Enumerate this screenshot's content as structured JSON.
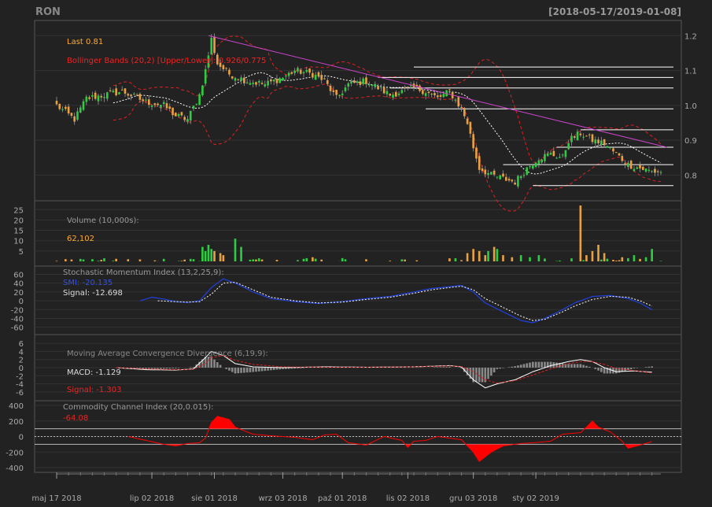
{
  "header": {
    "symbol": "RON",
    "range": "[2018-05-17/2019-01-08]"
  },
  "colors": {
    "up": "#2ecc40",
    "down": "#e8a040",
    "bbands": "#e02020",
    "sma": "#ffffff",
    "trend": "#cc44cc",
    "smi": "#2040e0",
    "cci": "#ff0000",
    "level": "#ffffff"
  },
  "chart_data": [
    {
      "type": "candlestick",
      "panel": "price",
      "labels": {
        "last": "Last 0.81",
        "bbands": "Bollinger Bands (20,2) [Upper/Lower]: 0.926/0.775"
      },
      "ylim": [
        0.74,
        1.23
      ],
      "yticks": [
        "0.8",
        "0.9",
        "1.0",
        "1.1",
        "1.2"
      ],
      "anchors": [
        [
          0,
          1.0
        ],
        [
          6,
          0.96
        ],
        [
          10,
          1.02
        ],
        [
          16,
          1.03
        ],
        [
          22,
          1.04
        ],
        [
          30,
          1.01
        ],
        [
          36,
          1.0
        ],
        [
          40,
          0.97
        ],
        [
          44,
          0.96
        ],
        [
          48,
          1.03
        ],
        [
          50,
          1.1
        ],
        [
          52,
          1.19
        ],
        [
          54,
          1.12
        ],
        [
          58,
          1.09
        ],
        [
          64,
          1.07
        ],
        [
          70,
          1.06
        ],
        [
          76,
          1.08
        ],
        [
          80,
          1.1
        ],
        [
          86,
          1.09
        ],
        [
          90,
          1.07
        ],
        [
          94,
          1.02
        ],
        [
          98,
          1.06
        ],
        [
          104,
          1.07
        ],
        [
          108,
          1.05
        ],
        [
          112,
          1.03
        ],
        [
          116,
          1.04
        ],
        [
          120,
          1.05
        ],
        [
          124,
          1.04
        ],
        [
          128,
          1.02
        ],
        [
          132,
          1.04
        ],
        [
          136,
          0.99
        ],
        [
          138,
          0.95
        ],
        [
          140,
          0.88
        ],
        [
          142,
          0.82
        ],
        [
          146,
          0.8
        ],
        [
          150,
          0.79
        ],
        [
          154,
          0.78
        ],
        [
          158,
          0.82
        ],
        [
          162,
          0.85
        ],
        [
          166,
          0.86
        ],
        [
          170,
          0.85
        ],
        [
          172,
          0.9
        ],
        [
          176,
          0.92
        ],
        [
          180,
          0.9
        ],
        [
          184,
          0.89
        ],
        [
          188,
          0.86
        ],
        [
          192,
          0.83
        ],
        [
          196,
          0.82
        ],
        [
          200,
          0.81
        ]
      ],
      "resistance_lines": [
        [
          120,
          1.11
        ],
        [
          108,
          1.08
        ],
        [
          112,
          1.05
        ],
        [
          124,
          0.99
        ],
        [
          176,
          0.93
        ],
        [
          168,
          0.88
        ],
        [
          150,
          0.83
        ],
        [
          160,
          0.77
        ]
      ],
      "trendline": [
        [
          51,
          1.2
        ],
        [
          205,
          0.88
        ]
      ]
    },
    {
      "type": "bar",
      "panel": "volume",
      "labels": {
        "title": "Volume (10,000s):",
        "last": "62,102"
      },
      "ylim": [
        0,
        27
      ],
      "yticks": [
        "5",
        "10",
        "15",
        "20",
        "25"
      ],
      "spikes": [
        [
          49,
          7
        ],
        [
          50,
          5
        ],
        [
          51,
          8
        ],
        [
          52,
          6
        ],
        [
          53,
          5
        ],
        [
          55,
          4
        ],
        [
          56,
          3
        ],
        [
          60,
          11
        ],
        [
          62,
          7
        ],
        [
          86,
          2
        ],
        [
          138,
          4
        ],
        [
          140,
          6
        ],
        [
          142,
          5
        ],
        [
          144,
          3
        ],
        [
          145,
          5
        ],
        [
          147,
          7
        ],
        [
          148,
          6
        ],
        [
          150,
          3
        ],
        [
          153,
          2
        ],
        [
          156,
          3
        ],
        [
          159,
          2
        ],
        [
          162,
          3
        ],
        [
          176,
          27
        ],
        [
          178,
          3
        ],
        [
          180,
          5
        ],
        [
          182,
          8
        ],
        [
          184,
          4
        ],
        [
          190,
          2
        ],
        [
          194,
          3
        ],
        [
          198,
          2
        ],
        [
          200,
          6
        ]
      ]
    },
    {
      "type": "line",
      "panel": "smi",
      "labels": {
        "title": "Stochastic Momentum Index (13,2,25,9):",
        "smi": "SMI: -20.135",
        "signal": "Signal: -12.698"
      },
      "ylim": [
        -66,
        68
      ],
      "yticks": [
        "-60",
        "-40",
        "-20",
        "0",
        "20",
        "40",
        "60"
      ],
      "smi_anchors": [
        [
          28,
          0
        ],
        [
          32,
          8
        ],
        [
          36,
          4
        ],
        [
          40,
          -2
        ],
        [
          44,
          -4
        ],
        [
          48,
          0
        ],
        [
          52,
          30
        ],
        [
          56,
          50
        ],
        [
          60,
          40
        ],
        [
          66,
          20
        ],
        [
          72,
          5
        ],
        [
          80,
          -2
        ],
        [
          88,
          -6
        ],
        [
          96,
          -2
        ],
        [
          104,
          5
        ],
        [
          112,
          10
        ],
        [
          120,
          20
        ],
        [
          126,
          28
        ],
        [
          132,
          32
        ],
        [
          136,
          35
        ],
        [
          140,
          20
        ],
        [
          144,
          -5
        ],
        [
          150,
          -25
        ],
        [
          156,
          -45
        ],
        [
          160,
          -50
        ],
        [
          164,
          -40
        ],
        [
          170,
          -20
        ],
        [
          174,
          -5
        ],
        [
          180,
          10
        ],
        [
          186,
          12
        ],
        [
          192,
          5
        ],
        [
          196,
          -5
        ],
        [
          200,
          -20
        ]
      ],
      "signal_anchors": [
        [
          34,
          0
        ],
        [
          40,
          -2
        ],
        [
          44,
          -3
        ],
        [
          48,
          -2
        ],
        [
          52,
          15
        ],
        [
          56,
          40
        ],
        [
          60,
          42
        ],
        [
          66,
          25
        ],
        [
          72,
          8
        ],
        [
          80,
          0
        ],
        [
          88,
          -5
        ],
        [
          96,
          -3
        ],
        [
          104,
          3
        ],
        [
          112,
          8
        ],
        [
          120,
          17
        ],
        [
          126,
          25
        ],
        [
          132,
          30
        ],
        [
          136,
          33
        ],
        [
          140,
          25
        ],
        [
          144,
          5
        ],
        [
          150,
          -15
        ],
        [
          156,
          -35
        ],
        [
          160,
          -45
        ],
        [
          164,
          -42
        ],
        [
          170,
          -25
        ],
        [
          174,
          -12
        ],
        [
          180,
          3
        ],
        [
          186,
          10
        ],
        [
          192,
          8
        ],
        [
          196,
          0
        ],
        [
          200,
          -12
        ]
      ]
    },
    {
      "type": "line",
      "panel": "macd",
      "labels": {
        "title": "Moving Average Convergence Divergence (6,19,9):",
        "macd": "MACD: -1.129",
        "signal": "Signal: -1.303"
      },
      "ylim": [
        -7,
        7
      ],
      "yticks": [
        "-6",
        "-4",
        "-2",
        "0",
        "2",
        "4",
        "6"
      ],
      "macd_anchors": [
        [
          20,
          0
        ],
        [
          30,
          -0.5
        ],
        [
          40,
          -0.6
        ],
        [
          46,
          -0.3
        ],
        [
          50,
          2.5
        ],
        [
          52,
          4
        ],
        [
          56,
          3
        ],
        [
          60,
          1
        ],
        [
          66,
          0.2
        ],
        [
          76,
          0
        ],
        [
          90,
          0.2
        ],
        [
          104,
          0.1
        ],
        [
          120,
          0.2
        ],
        [
          132,
          0.5
        ],
        [
          136,
          0.2
        ],
        [
          140,
          -3
        ],
        [
          144,
          -5
        ],
        [
          148,
          -4
        ],
        [
          154,
          -3
        ],
        [
          160,
          -1
        ],
        [
          166,
          0.5
        ],
        [
          172,
          1.5
        ],
        [
          176,
          2
        ],
        [
          180,
          1.5
        ],
        [
          184,
          0
        ],
        [
          188,
          -1
        ],
        [
          194,
          -0.8
        ],
        [
          200,
          -1.129
        ]
      ],
      "signal_anchors": [
        [
          20,
          0
        ],
        [
          30,
          -0.3
        ],
        [
          40,
          -0.5
        ],
        [
          46,
          -0.4
        ],
        [
          50,
          1
        ],
        [
          52,
          2.5
        ],
        [
          56,
          3
        ],
        [
          60,
          1.8
        ],
        [
          66,
          0.8
        ],
        [
          76,
          0.2
        ],
        [
          90,
          0.1
        ],
        [
          104,
          0.1
        ],
        [
          120,
          0.2
        ],
        [
          132,
          0.4
        ],
        [
          136,
          0.3
        ],
        [
          140,
          -1
        ],
        [
          144,
          -3
        ],
        [
          148,
          -3.8
        ],
        [
          154,
          -3.2
        ],
        [
          160,
          -1.8
        ],
        [
          166,
          -0.3
        ],
        [
          172,
          1
        ],
        [
          176,
          1.5
        ],
        [
          180,
          1.5
        ],
        [
          184,
          0.8
        ],
        [
          188,
          -0.2
        ],
        [
          194,
          -0.7
        ],
        [
          200,
          -1.303
        ]
      ]
    },
    {
      "type": "area",
      "panel": "cci",
      "labels": {
        "title": "Commodity Channel Index (20,0.015):",
        "last": "-64.08"
      },
      "ylim": [
        -400,
        400
      ],
      "yticks": [
        "-400",
        "-200",
        "0",
        "200",
        "400"
      ],
      "levels": [
        100,
        -100
      ],
      "anchors": [
        [
          24,
          0
        ],
        [
          30,
          -50
        ],
        [
          36,
          -100
        ],
        [
          40,
          -120
        ],
        [
          44,
          -90
        ],
        [
          48,
          -80
        ],
        [
          50,
          -20
        ],
        [
          52,
          180
        ],
        [
          54,
          260
        ],
        [
          58,
          220
        ],
        [
          60,
          120
        ],
        [
          66,
          30
        ],
        [
          72,
          10
        ],
        [
          80,
          -10
        ],
        [
          86,
          -40
        ],
        [
          90,
          20
        ],
        [
          94,
          30
        ],
        [
          98,
          -80
        ],
        [
          104,
          -110
        ],
        [
          110,
          0
        ],
        [
          116,
          -50
        ],
        [
          118,
          -140
        ],
        [
          120,
          -60
        ],
        [
          124,
          -50
        ],
        [
          128,
          0
        ],
        [
          132,
          -20
        ],
        [
          136,
          -40
        ],
        [
          140,
          -200
        ],
        [
          142,
          -320
        ],
        [
          146,
          -200
        ],
        [
          150,
          -120
        ],
        [
          156,
          -90
        ],
        [
          160,
          -80
        ],
        [
          166,
          -60
        ],
        [
          170,
          30
        ],
        [
          176,
          50
        ],
        [
          178,
          120
        ],
        [
          180,
          200
        ],
        [
          182,
          120
        ],
        [
          186,
          60
        ],
        [
          190,
          -60
        ],
        [
          192,
          -150
        ],
        [
          196,
          -110
        ],
        [
          200,
          -64.08
        ]
      ]
    },
    {
      "type": "axis",
      "x_tick_labels": [
        {
          "label": "maj 17 2018",
          "index": 0
        },
        {
          "label": "lip 02 2018",
          "index": 32
        },
        {
          "label": "sie 01 2018",
          "index": 53
        },
        {
          "label": "wrz 03 2018",
          "index": 76
        },
        {
          "label": "paź 01 2018",
          "index": 96
        },
        {
          "label": "lis 02 2018",
          "index": 118
        },
        {
          "label": "gru 03 2018",
          "index": 140
        },
        {
          "label": "sty 02 2019",
          "index": 161
        }
      ],
      "n_points": 204
    }
  ]
}
